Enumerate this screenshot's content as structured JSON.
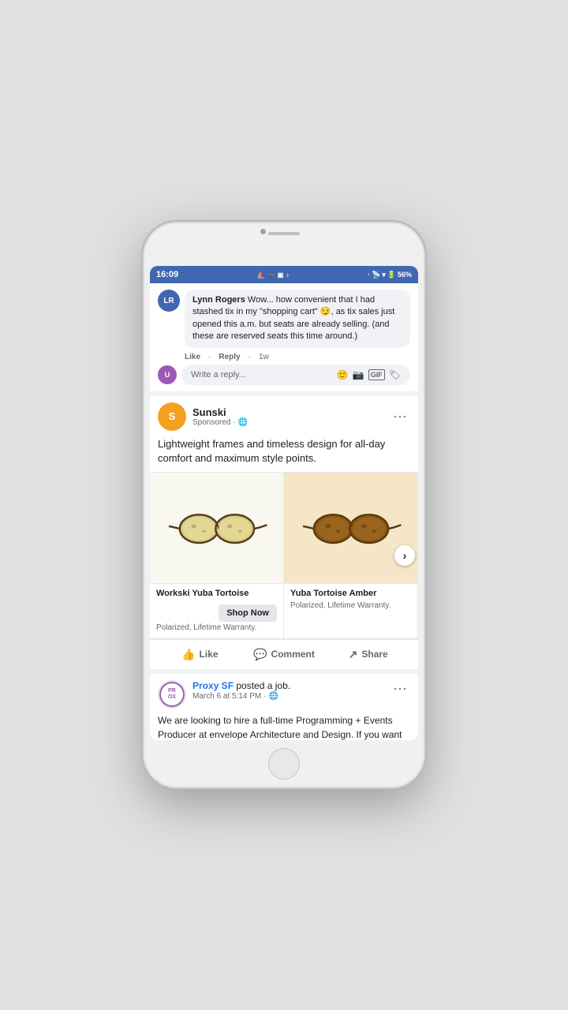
{
  "status_bar": {
    "time": "16:09",
    "battery": "56%",
    "signal_dot": "·"
  },
  "comment": {
    "author_name": "Lynn Rogers",
    "author_initials": "LR",
    "author_avatar_color": "#4267B2",
    "text": "Wow... how convenient that I had stashed tix in my \"shopping cart\" 😏, as tix sales just opened this a.m. but seats are already selling. (and these are reserved seats this time around.)",
    "like_label": "Like",
    "reply_label": "Reply",
    "time_ago": "1w",
    "reply_placeholder": "Write a reply..."
  },
  "ad_post": {
    "brand_name": "Sunski",
    "brand_initials": "S",
    "brand_avatar_color": "#f4a020",
    "sponsored_label": "Sponsored",
    "more_dots": "···",
    "post_text": "Lightweight frames and timeless design for all-day comfort and maximum style points.",
    "products": [
      {
        "name": "Workski Yuba Tortoise",
        "description": "Polarized, Lifetime Warranty.",
        "shop_label": "Shop Now",
        "bg_type": "white"
      },
      {
        "name": "Yuba Tortoise Amber",
        "description": "Polarized, Lifetime Warranty.",
        "bg_type": "beige"
      }
    ],
    "carousel_next": "›",
    "actions": {
      "like_label": "Like",
      "comment_label": "Comment",
      "share_label": "Share"
    }
  },
  "job_post": {
    "brand_name": "Proxy SF",
    "brand_initials": "PR\nOX",
    "brand_avatar_color": "#9b59b6",
    "action_text": "posted a job.",
    "date": "March 6 at 5:14 PM",
    "more_dots": "···",
    "text": "We are looking to hire a full-time Programming + Events Producer at envelope Architecture and Design. If you want to work with a team of passionate architects and designers working on unconventional place-",
    "globe_icon": "🌐"
  }
}
